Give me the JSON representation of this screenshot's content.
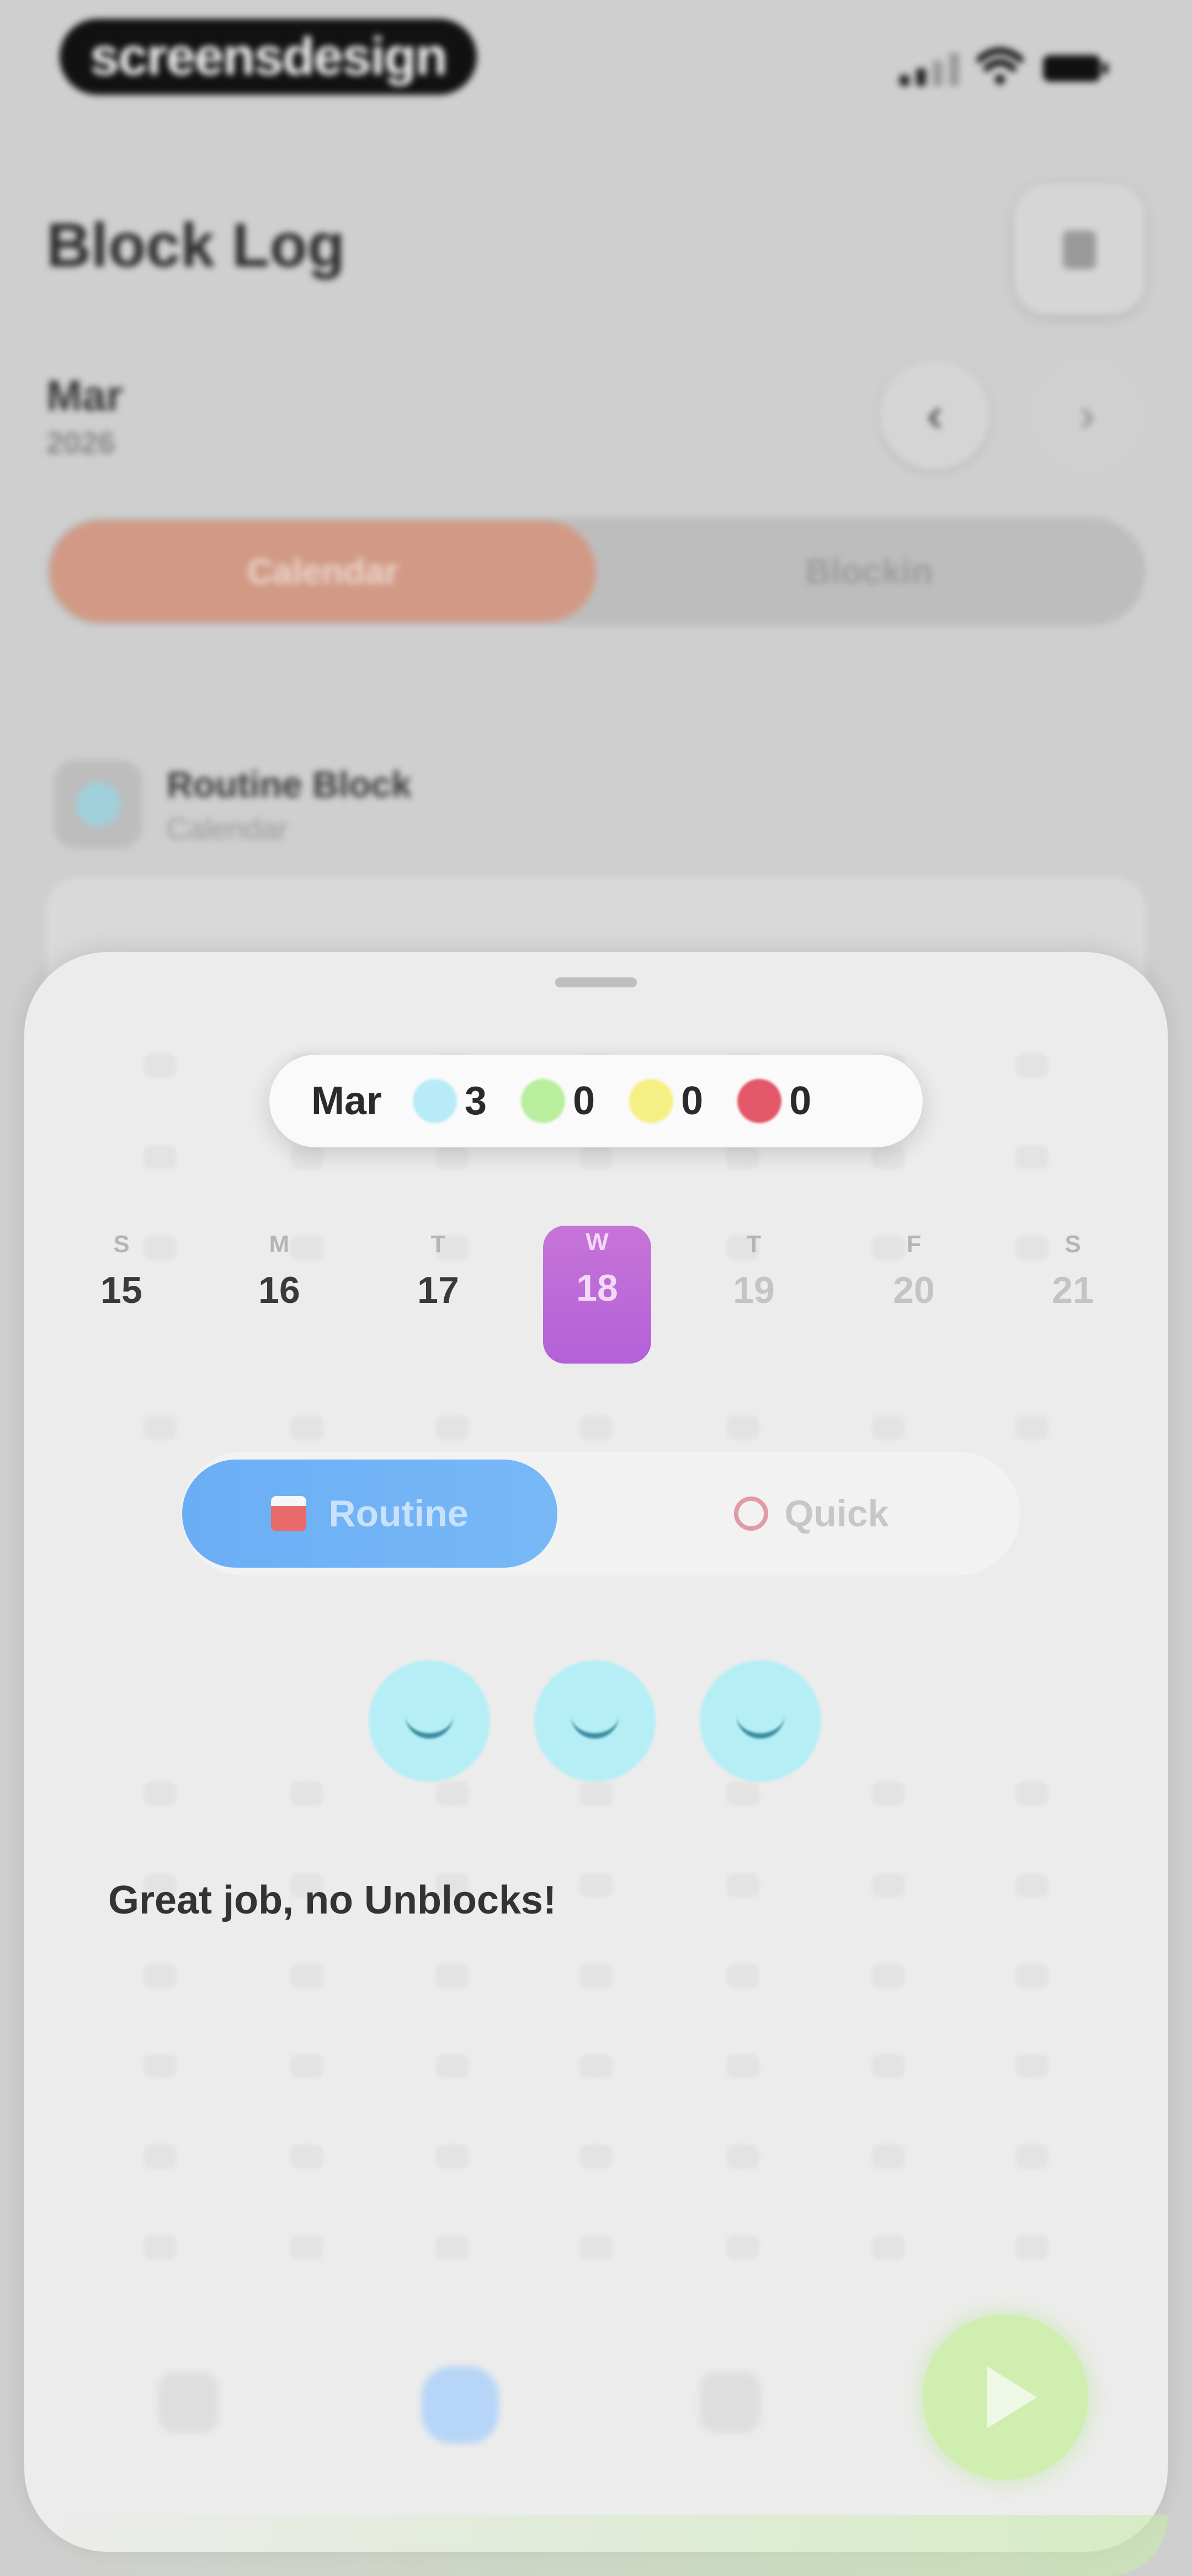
{
  "brand": {
    "text": "screensdesign"
  },
  "header": {
    "title": "Block Log"
  },
  "period": {
    "month": "Mar",
    "year": "2026"
  },
  "segments": {
    "calendar": "Calendar",
    "blockin": "Blockin"
  },
  "routine_item": {
    "title": "Routine Block",
    "subtitle": "Calendar"
  },
  "sheet": {
    "stats": {
      "month": "Mar",
      "items": [
        {
          "color": "#b7ebf7",
          "value": "3"
        },
        {
          "color": "#b9ee9e",
          "value": "0"
        },
        {
          "color": "#f6ef86",
          "value": "0"
        },
        {
          "color": "#e25868",
          "value": "0"
        }
      ]
    },
    "week": [
      {
        "letter": "S",
        "number": "15"
      },
      {
        "letter": "M",
        "number": "16"
      },
      {
        "letter": "T",
        "number": "17"
      },
      {
        "letter": "W",
        "number": "18"
      },
      {
        "letter": "T",
        "number": "19"
      },
      {
        "letter": "F",
        "number": "20"
      },
      {
        "letter": "S",
        "number": "21"
      }
    ],
    "tabs": {
      "routine": "Routine",
      "quick": "Quick"
    },
    "message": "Great job, no Unblocks!"
  }
}
